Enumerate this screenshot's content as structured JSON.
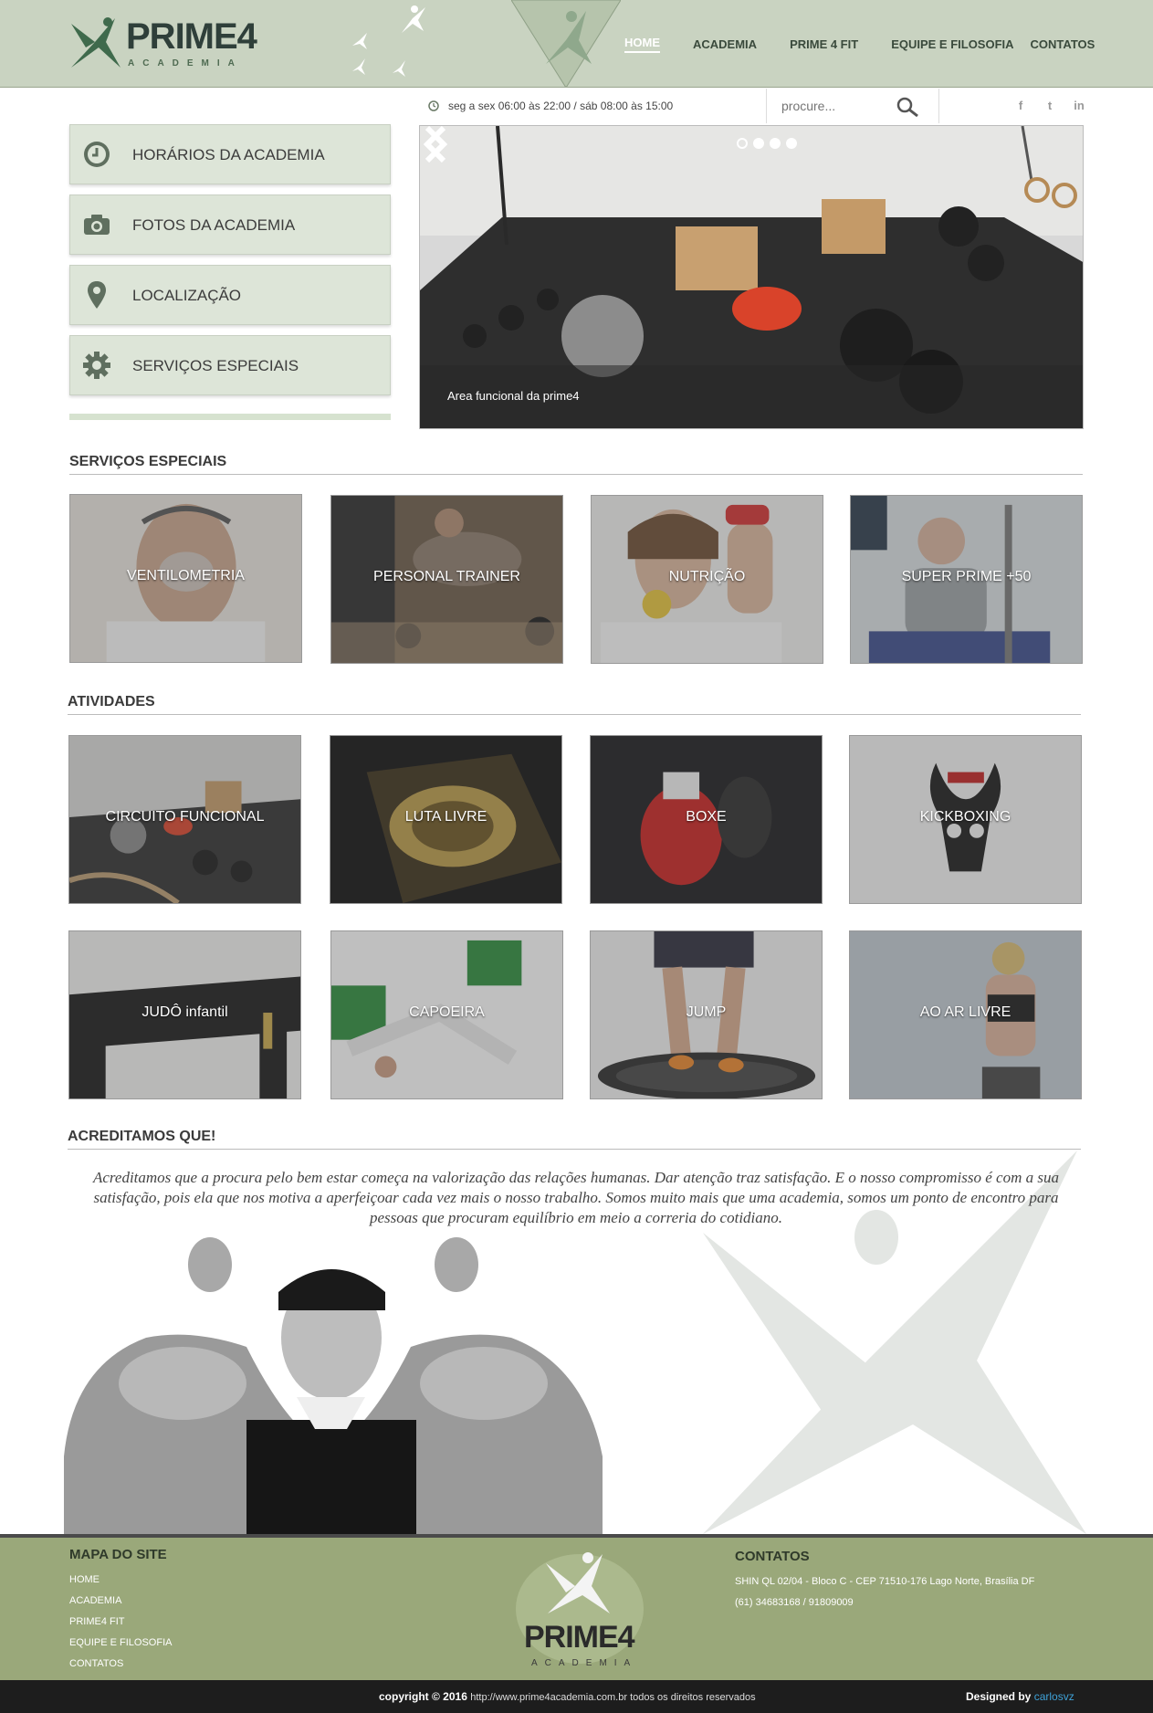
{
  "header": {
    "logo_word": "PRIME4",
    "logo_sub": "ACADEMIA",
    "nav": [
      {
        "label": "HOME",
        "active": true
      },
      {
        "label": "ACADEMIA"
      },
      {
        "label": "PRIME 4 FIT"
      },
      {
        "label": "EQUIPE E FILOSOFIA"
      },
      {
        "label": "CONTATOS"
      }
    ]
  },
  "topbar": {
    "hours": "seg a sex 06:00 às 22:00 / sáb 08:00 às 15:00",
    "search_placeholder": "procure...",
    "social": [
      "f",
      "t",
      "in"
    ]
  },
  "side_menu": [
    {
      "label": "HORÁRIOS DA ACADEMIA",
      "icon": "clock-icon"
    },
    {
      "label": "FOTOS DA ACADEMIA",
      "icon": "camera-icon"
    },
    {
      "label": "LOCALIZAÇÃO",
      "icon": "map-pin-icon"
    },
    {
      "label": "SERVIÇOS ESPECIAIS",
      "icon": "gear-icon"
    }
  ],
  "slider": {
    "caption": "Area funcional da prime4",
    "dots": 4,
    "active_dot": 1
  },
  "sections": {
    "servicos_title": "SERVIÇOS ESPECIAIS",
    "atividades_title": "ATIVIDADES",
    "acreditamos_title": "ACREDITAMOS QUE!"
  },
  "servicos": [
    "VENTILOMETRIA",
    "PERSONAL TRAINER",
    "NUTRIÇÃO",
    "SUPER PRIME +50"
  ],
  "atividades": [
    "CIRCUITO FUNCIONAL",
    "LUTA LIVRE",
    "BOXE",
    "KICKBOXING",
    "JUDÔ infantil",
    "CAPOEIRA",
    "JUMP",
    "AO AR LIVRE"
  ],
  "belief_text": "Acreditamos que a procura pelo bem estar começa na valorização das relações humanas. Dar atenção traz satisfação. E o nosso compromisso é com a sua satisfação, pois ela que nos motiva a aperfeiçoar cada vez mais o nosso trabalho. Somos muito mais que uma academia, somos um ponto de encontro para pessoas que procuram equilíbrio em meio a correria do cotidiano.",
  "footer": {
    "map_title": "MAPA DO SITE",
    "map_links": [
      "HOME",
      "ACADEMIA",
      "PRIME4 FIT",
      "EQUIPE E FILOSOFIA",
      "CONTATOS"
    ],
    "contacts_title": "CONTATOS",
    "address": "SHIN QL 02/04 - Bloco C - CEP 71510-176 Lago Norte, Brasília DF",
    "phones": "(61) 34683168 / 91809009",
    "logo_word": "PRIME4",
    "logo_sub": "ACADEMIA",
    "copyright": "copyright © 2016",
    "copyright_url": "http://www.prime4academia.com.br todos os direitos reservados",
    "designed_label": "Designed by",
    "designer": "carlosvz"
  },
  "colors": {
    "header_bg": "#c9d3c1",
    "side_item_bg": "#dde5d8",
    "footer_bg": "#9aa87a",
    "copybar_bg": "#1d1d1d",
    "designer_link": "#3fa2d8"
  }
}
